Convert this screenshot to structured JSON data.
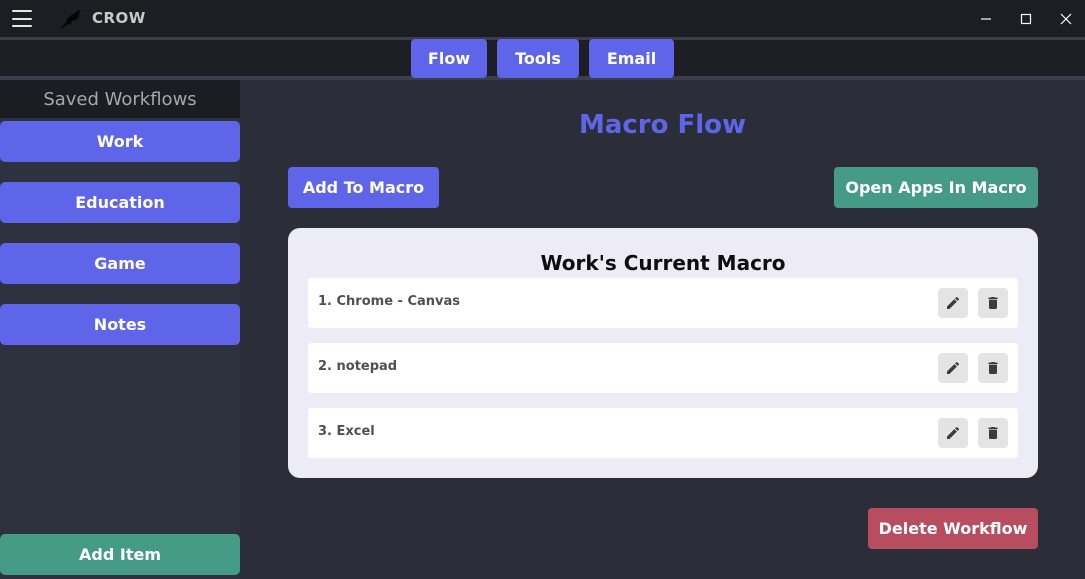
{
  "app": {
    "title": "CROW"
  },
  "nav": {
    "tabs": [
      {
        "label": "Flow"
      },
      {
        "label": "Tools"
      },
      {
        "label": "Email"
      }
    ]
  },
  "sidebar": {
    "header": "Saved Workflows",
    "items": [
      {
        "label": "Work"
      },
      {
        "label": "Education"
      },
      {
        "label": "Game"
      },
      {
        "label": "Notes"
      }
    ],
    "add_item_label": "Add Item"
  },
  "main": {
    "title": "Macro Flow",
    "add_to_macro_label": "Add To Macro",
    "open_apps_label": "Open Apps In Macro",
    "card_title": "Work's Current Macro",
    "macro_items": [
      {
        "label": "1. Chrome - Canvas"
      },
      {
        "label": "2. notepad"
      },
      {
        "label": "3. Excel"
      }
    ],
    "delete_workflow_label": "Delete Workflow"
  },
  "colors": {
    "accent": "#5f65e8",
    "success": "#459b86",
    "danger": "#b84d5f",
    "background": "#2b2e39",
    "titlebar": "#1d1e24"
  },
  "icons": {
    "menu": "hamburger-icon",
    "logo": "crow-icon",
    "minimize": "minimize-icon",
    "maximize": "maximize-icon",
    "close": "close-icon",
    "edit": "pencil-icon",
    "delete": "trash-icon"
  }
}
